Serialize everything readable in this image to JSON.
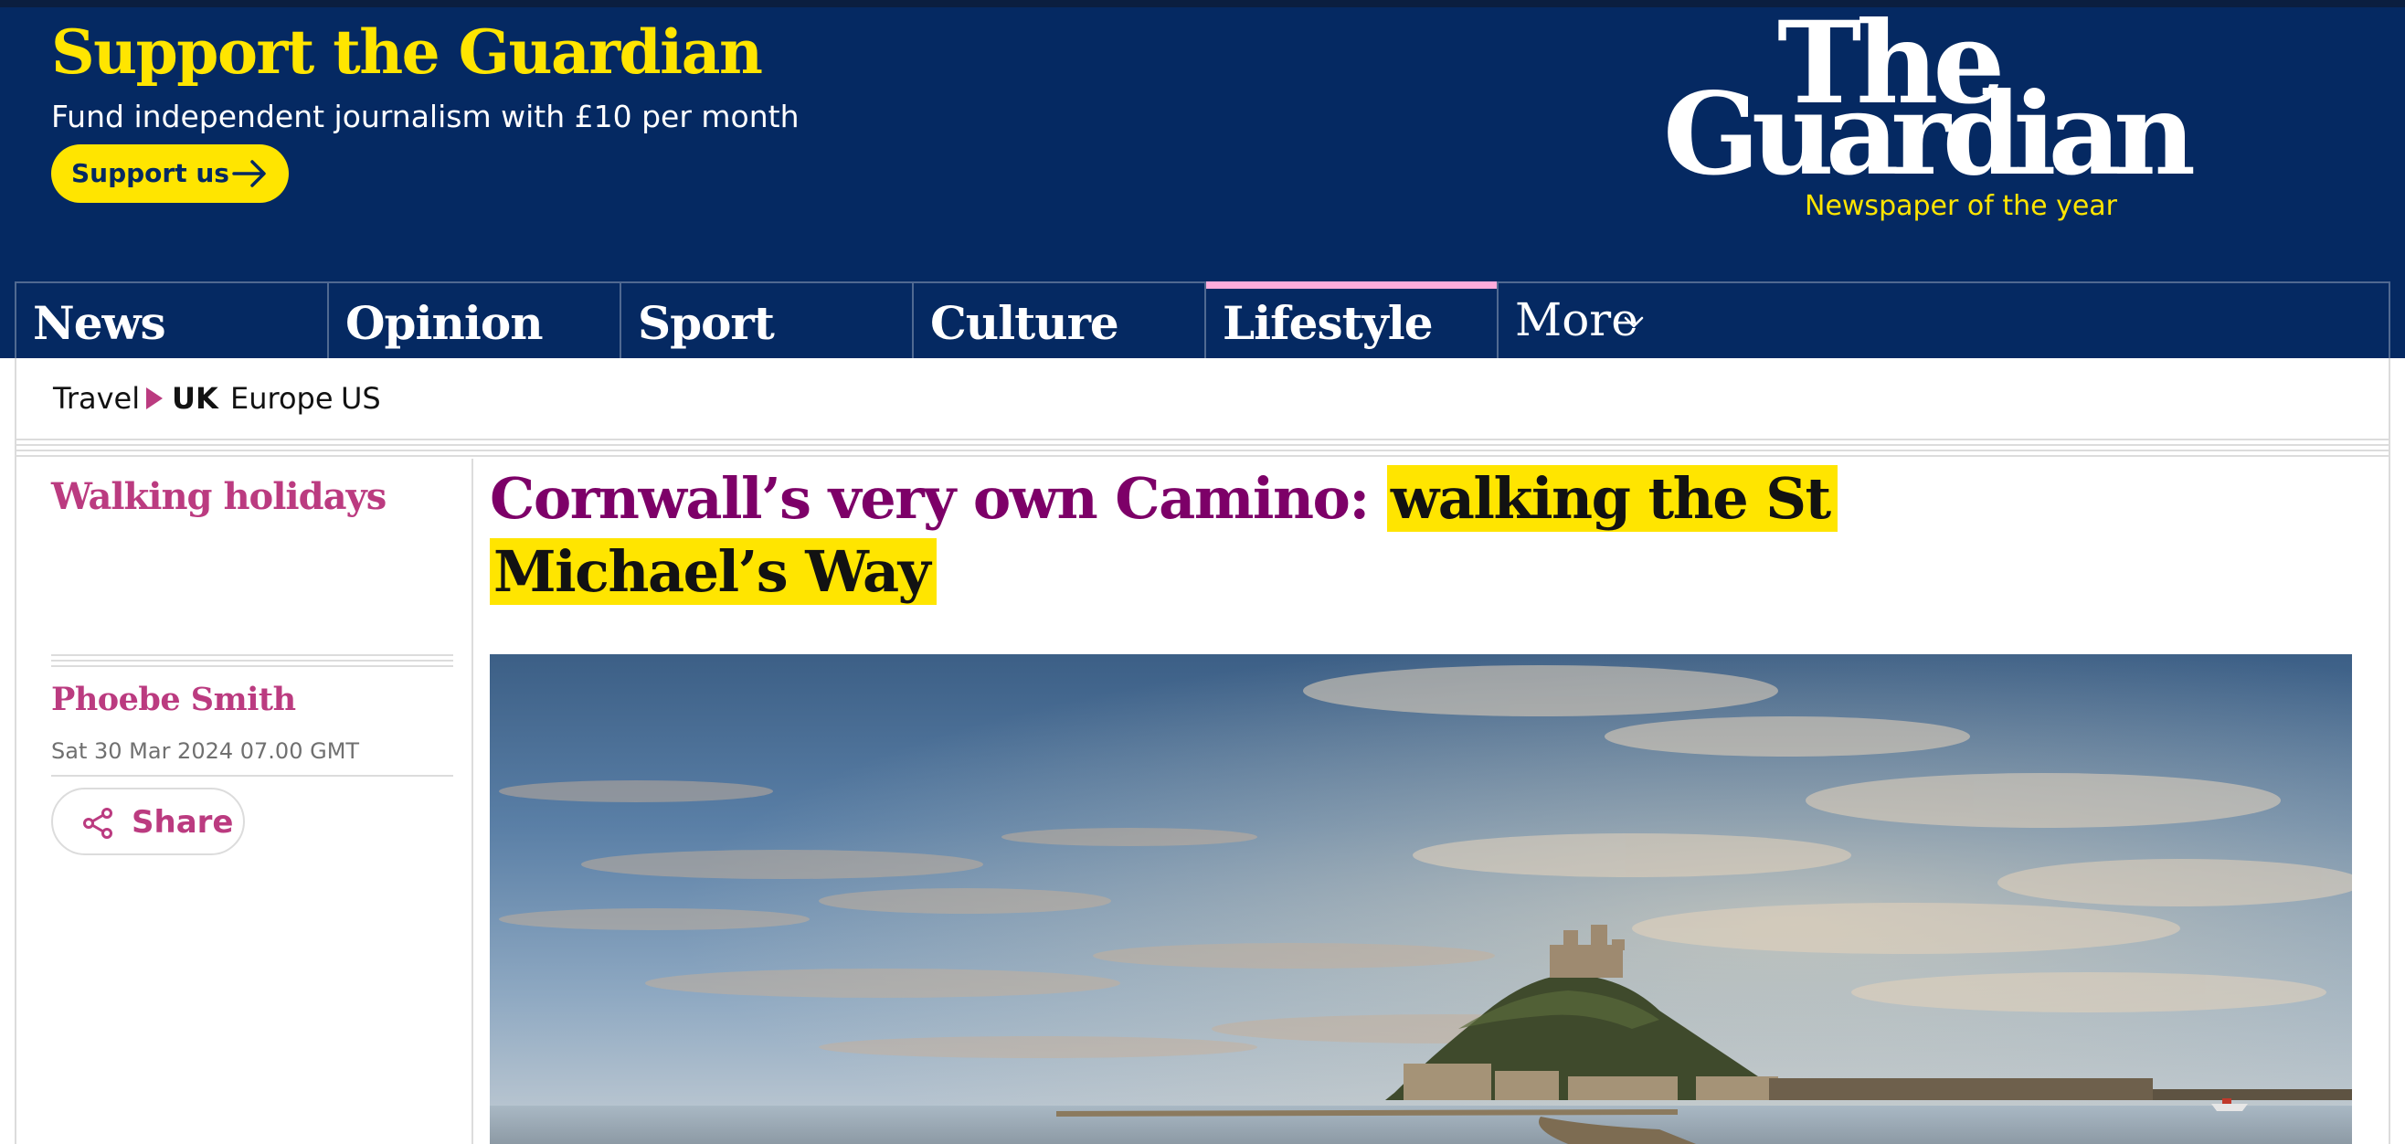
{
  "support": {
    "title": "Support the Guardian",
    "subtitle": "Fund independent journalism with £10 per month",
    "button_label": "Support us"
  },
  "logo": {
    "line1": "The",
    "line2": "Guardian",
    "tagline": "Newspaper of the year"
  },
  "pillars": {
    "news": "News",
    "opinion": "Opinion",
    "sport": "Sport",
    "culture": "Culture",
    "lifestyle": "Lifestyle",
    "more": "More",
    "active": "Lifestyle"
  },
  "subnav": {
    "travel": "Travel",
    "uk": "UK",
    "europe": "Europe",
    "us": "US",
    "selected": "UK"
  },
  "article": {
    "series": "Walking holidays",
    "headline_kicker": "Cornwall’s very own Camino:",
    "headline_main": "walking the St Michael’s Way",
    "byline": "Phoebe Smith",
    "date": "Sat 30 Mar 2024 07.00 GMT",
    "share_label": "Share"
  },
  "icons": {
    "support_arrow": "arrow-right-icon",
    "more_chevron": "chevron-down-icon",
    "subnav_marker": "triangle-right-icon",
    "share": "share-icon"
  },
  "colors": {
    "brand_blue": "#052962",
    "brand_yellow": "#ffe500",
    "lifestyle_pink": "#ffabdb",
    "lifestyle_purple": "#7d0068",
    "lifestyle_accent": "#bb3b80"
  }
}
